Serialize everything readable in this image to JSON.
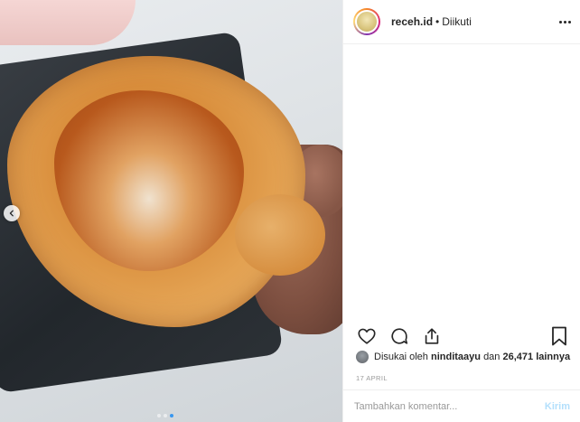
{
  "post": {
    "username": "receh.id",
    "separator": "•",
    "follow_status": "Diikuti",
    "likes_text": {
      "prefix": "Disukai oleh",
      "user": "ninditaayu",
      "mid": "dan",
      "count": "26,471",
      "suffix": "lainnya"
    },
    "date": "17 APRIL",
    "carousel": {
      "total_slides": 3,
      "active_slide": 3
    }
  },
  "comment": {
    "placeholder": "Tambahkan komentar...",
    "send_label": "Kirim"
  },
  "icons": {
    "like": "heart-icon",
    "comment": "comment-icon",
    "share": "share-icon",
    "save": "bookmark-icon",
    "more": "more-options-icon",
    "prev": "chevron-left-icon"
  },
  "colors": {
    "accent": "#3897f0",
    "send_disabled": "#b2dffc",
    "text": "#262626",
    "muted": "#999999"
  }
}
